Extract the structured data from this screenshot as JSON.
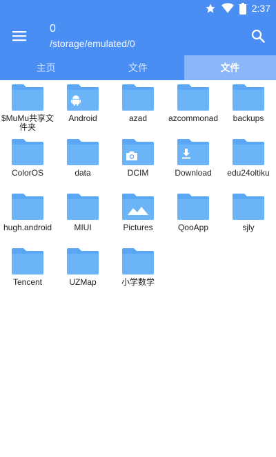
{
  "status": {
    "time": "2:37"
  },
  "header": {
    "title": "0",
    "path": "/storage/emulated/0"
  },
  "tabs": [
    {
      "label": "主页",
      "active": false
    },
    {
      "label": "文件",
      "active": false
    },
    {
      "label": "文件",
      "active": true
    }
  ],
  "colors": {
    "primary": "#4a8ef4",
    "tab_active_bg": "#8ab7f8",
    "folder": "#5aa8f5"
  },
  "folders": [
    {
      "name": "$MuMu共享文件夹",
      "badge": "none"
    },
    {
      "name": "Android",
      "badge": "android-icon"
    },
    {
      "name": "azad",
      "badge": "none"
    },
    {
      "name": "azcommonad",
      "badge": "none"
    },
    {
      "name": "backups",
      "badge": "none"
    },
    {
      "name": "ColorOS",
      "badge": "none"
    },
    {
      "name": "data",
      "badge": "none"
    },
    {
      "name": "DCIM",
      "badge": "camera-icon"
    },
    {
      "name": "Download",
      "badge": "download-icon"
    },
    {
      "name": "edu24oltiku",
      "badge": "none"
    },
    {
      "name": "hugh.android",
      "badge": "none"
    },
    {
      "name": "MIUI",
      "badge": "none"
    },
    {
      "name": "Pictures",
      "badge": "image-icon"
    },
    {
      "name": "QooApp",
      "badge": "none"
    },
    {
      "name": "sjly",
      "badge": "none"
    },
    {
      "name": "Tencent",
      "badge": "none"
    },
    {
      "name": "UZMap",
      "badge": "none"
    },
    {
      "name": "小学数学",
      "badge": "none"
    }
  ]
}
